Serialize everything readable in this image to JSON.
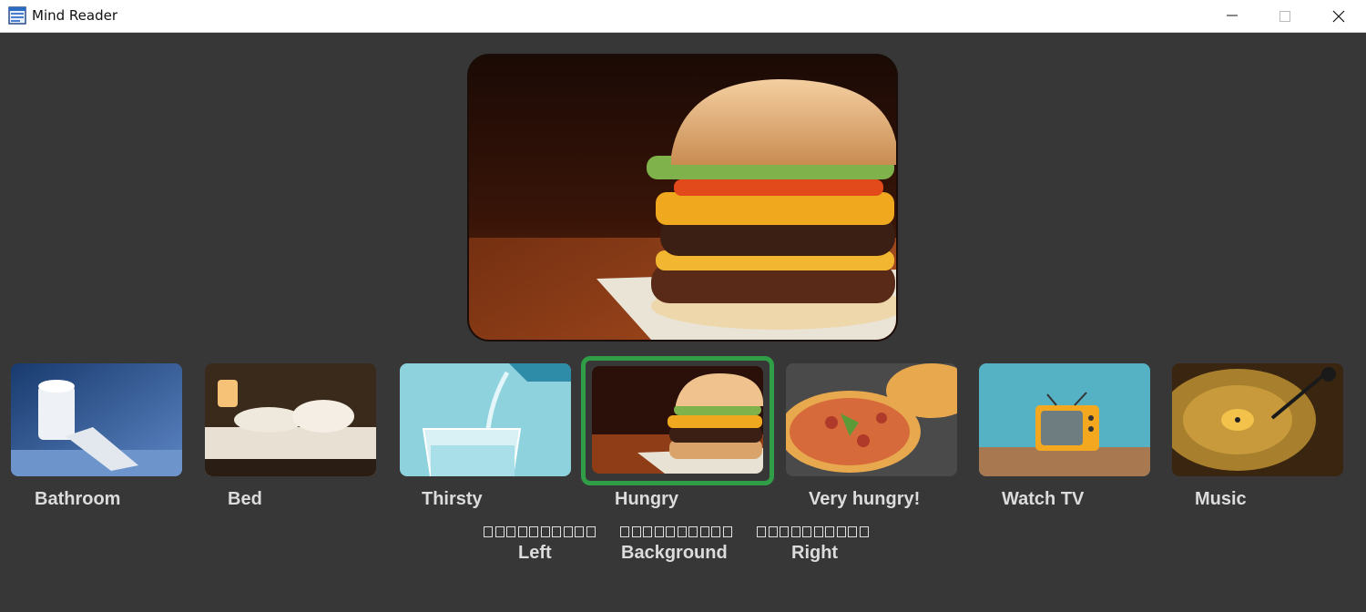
{
  "window": {
    "title": "Mind Reader",
    "controls": [
      "minimize-icon",
      "maximize-icon",
      "close-icon"
    ]
  },
  "main_image": {
    "subject": "burger-image"
  },
  "options": [
    {
      "label": "Bathroom"
    },
    {
      "label": "Bed"
    },
    {
      "label": "Thirsty"
    },
    {
      "label": "Hungry",
      "selected": true
    },
    {
      "label": "Very hungry!"
    },
    {
      "label": "Watch TV"
    },
    {
      "label": "Music"
    }
  ],
  "meters": [
    {
      "label": "Left",
      "cells": 10
    },
    {
      "label": "Background",
      "cells": 10
    },
    {
      "label": "Right",
      "cells": 10
    }
  ],
  "colors": {
    "background": "#373737",
    "selection": "#2f9e47",
    "label_text": "#dcdcdc"
  }
}
